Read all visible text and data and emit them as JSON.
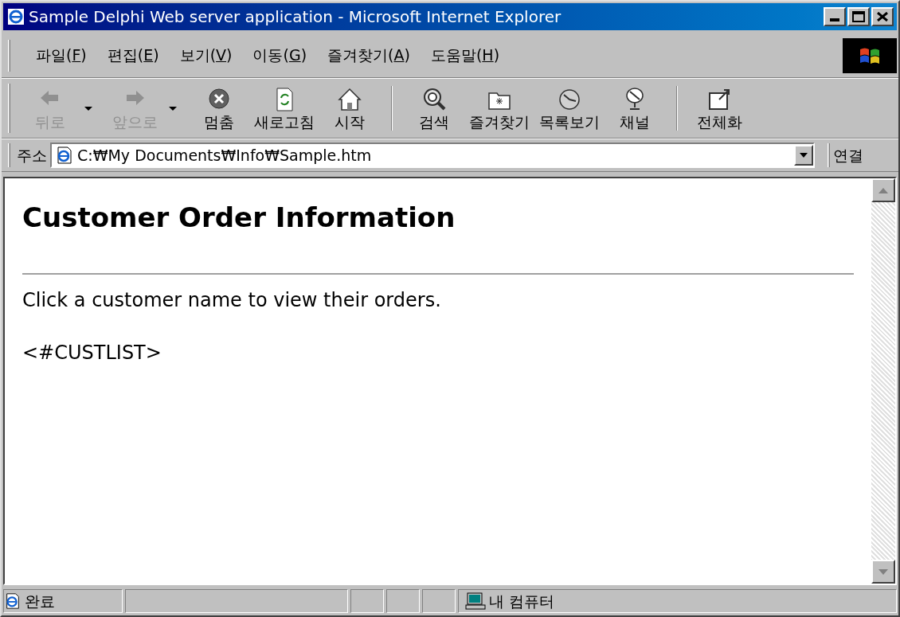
{
  "window": {
    "title": "Sample Delphi Web server application - Microsoft Internet Explorer"
  },
  "menu": [
    {
      "before": "파일(",
      "key": "F",
      "after": ")"
    },
    {
      "before": "편집(",
      "key": "E",
      "after": ")"
    },
    {
      "before": "보기(",
      "key": "V",
      "after": ")"
    },
    {
      "before": "이동(",
      "key": "G",
      "after": ")"
    },
    {
      "before": "즐겨찾기(",
      "key": "A",
      "after": ")"
    },
    {
      "before": "도움말(",
      "key": "H",
      "after": ")"
    }
  ],
  "toolbar": [
    {
      "kind": "back",
      "label": "뒤로",
      "disabled": true,
      "dropdown": true
    },
    {
      "kind": "forward",
      "label": "앞으로",
      "disabled": true,
      "dropdown": true
    },
    {
      "kind": "stop",
      "label": "멈춤",
      "disabled": false,
      "dropdown": false
    },
    {
      "kind": "refresh",
      "label": "새로고침",
      "disabled": false,
      "dropdown": false
    },
    {
      "kind": "home",
      "label": "시작",
      "disabled": false,
      "dropdown": false
    },
    {
      "kind": "separator"
    },
    {
      "kind": "search",
      "label": "검색",
      "disabled": false,
      "dropdown": false
    },
    {
      "kind": "favorites",
      "label": "즐겨찾기",
      "disabled": false,
      "dropdown": false
    },
    {
      "kind": "history",
      "label": "목록보기",
      "disabled": false,
      "dropdown": false
    },
    {
      "kind": "channels",
      "label": "채널",
      "disabled": false,
      "dropdown": false
    },
    {
      "kind": "separator"
    },
    {
      "kind": "fullscreen",
      "label": "전체화",
      "disabled": false,
      "dropdown": false
    }
  ],
  "address_bar": {
    "label": "주소",
    "value": "C:₩My Documents₩Info₩Sample.htm",
    "go_label": "연결"
  },
  "page": {
    "heading": "Customer Order Information",
    "text": "Click a customer name to view their orders.",
    "tag": "<#CUSTLIST>"
  },
  "status_bar": {
    "text": "완료",
    "zone": "내 컴퓨터"
  }
}
